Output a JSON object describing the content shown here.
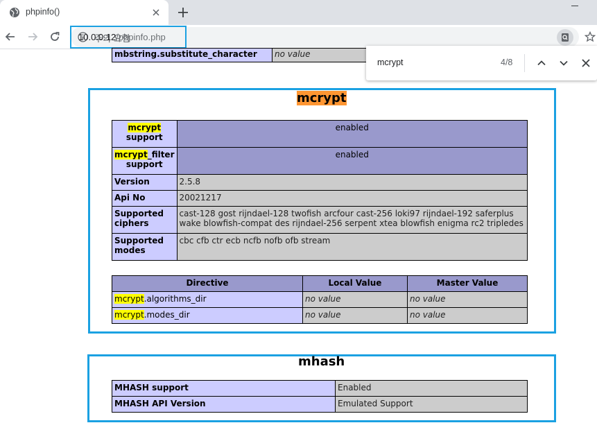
{
  "browser": {
    "tab_title": "phpinfo()",
    "security_label": "주의 요함",
    "url_host": "10.0.0.12",
    "url_path": "/phpinfo.php"
  },
  "find": {
    "query": "mcrypt",
    "count": "4/8"
  },
  "top_row": {
    "label": "mbstring.substitute_character",
    "value": "no value"
  },
  "mcrypt": {
    "title": "mcrypt",
    "rows": [
      {
        "hl": "mcrypt",
        "label": " support",
        "value": "enabled"
      },
      {
        "hl": "mcrypt",
        "label": "_filter support",
        "value": "enabled"
      },
      {
        "label": "Version",
        "value": "2.5.8"
      },
      {
        "label": "Api No",
        "value": "20021217"
      },
      {
        "label": "Supported ciphers",
        "value": "cast-128 gost rijndael-128 twofish arcfour cast-256 loki97 rijndael-192 saferplus wake blowfish-compat des rijndael-256 serpent xtea blowfish enigma rc2 tripledes"
      },
      {
        "label": "Supported modes",
        "value": "cbc cfb ctr ecb ncfb nofb ofb stream"
      }
    ],
    "directive_headers": [
      "Directive",
      "Local Value",
      "Master Value"
    ],
    "directives": [
      {
        "hl": "mcrypt",
        "name": ".algorithms_dir",
        "local": "no value",
        "master": "no value"
      },
      {
        "hl": "mcrypt",
        "name": ".modes_dir",
        "local": "no value",
        "master": "no value"
      }
    ]
  },
  "mhash": {
    "title": "mhash",
    "rows": [
      {
        "label": "MHASH support",
        "value": "Enabled"
      },
      {
        "label": "MHASH API Version",
        "value": "Emulated Support"
      }
    ]
  }
}
